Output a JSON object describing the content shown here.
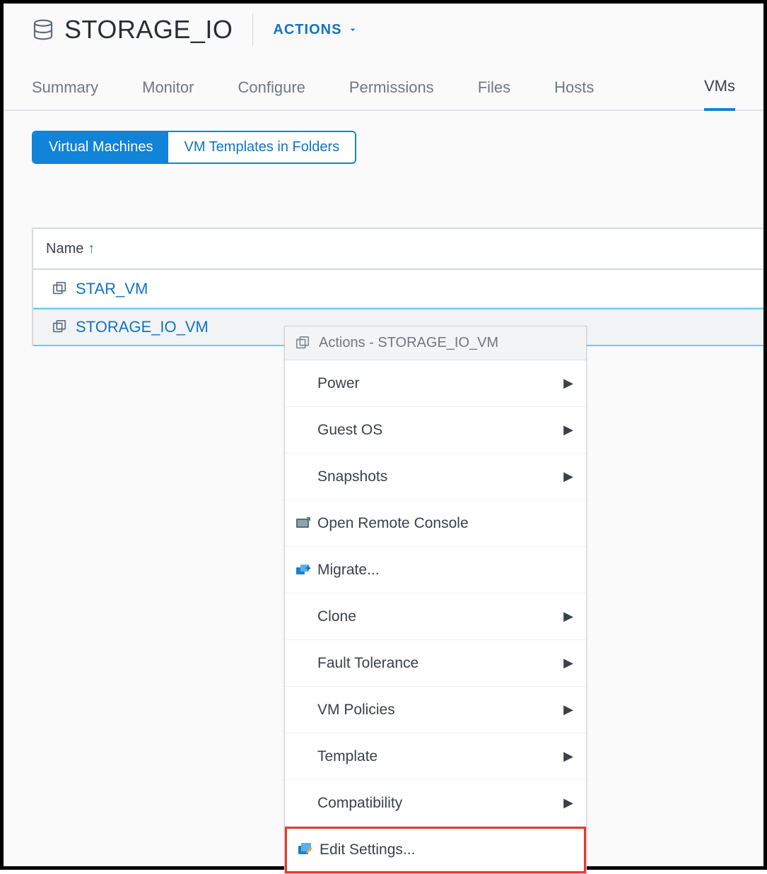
{
  "header": {
    "title": "STORAGE_IO",
    "actions_label": "ACTIONS"
  },
  "tabs": {
    "items": [
      {
        "label": "Summary"
      },
      {
        "label": "Monitor"
      },
      {
        "label": "Configure"
      },
      {
        "label": "Permissions"
      },
      {
        "label": "Files"
      },
      {
        "label": "Hosts"
      },
      {
        "label": "VMs"
      }
    ]
  },
  "subtabs": {
    "items": [
      {
        "label": "Virtual Machines"
      },
      {
        "label": "VM Templates in Folders"
      }
    ]
  },
  "table": {
    "header": {
      "name": "Name",
      "sort_glyph": "↑"
    },
    "rows": [
      {
        "name": "STAR_VM"
      },
      {
        "name": "STORAGE_IO_VM"
      }
    ]
  },
  "context_menu": {
    "title": "Actions - STORAGE_IO_VM",
    "items": [
      {
        "label": "Power",
        "has_submenu": true,
        "icon": null
      },
      {
        "label": "Guest OS",
        "has_submenu": true,
        "icon": null
      },
      {
        "label": "Snapshots",
        "has_submenu": true,
        "icon": null
      },
      {
        "label": "Open Remote Console",
        "has_submenu": false,
        "icon": "console"
      },
      {
        "label": "Migrate...",
        "has_submenu": false,
        "icon": "migrate"
      },
      {
        "label": "Clone",
        "has_submenu": true,
        "icon": null
      },
      {
        "label": "Fault Tolerance",
        "has_submenu": true,
        "icon": null
      },
      {
        "label": "VM Policies",
        "has_submenu": true,
        "icon": null
      },
      {
        "label": "Template",
        "has_submenu": true,
        "icon": null
      },
      {
        "label": "Compatibility",
        "has_submenu": true,
        "icon": null
      },
      {
        "label": "Edit Settings...",
        "has_submenu": false,
        "icon": "edit",
        "highlighted": true
      }
    ]
  }
}
